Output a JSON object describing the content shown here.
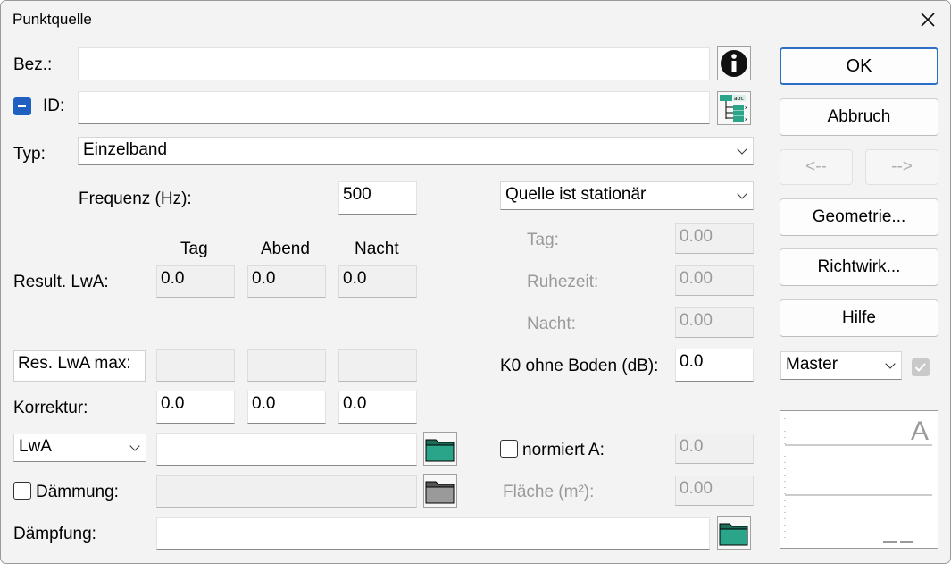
{
  "window": {
    "title": "Punktquelle"
  },
  "labels": {
    "bez": "Bez.:",
    "id": "ID:",
    "typ": "Typ:",
    "frequenz": "Frequenz (Hz):",
    "tag": "Tag",
    "abend": "Abend",
    "nacht": "Nacht",
    "result": "Result. LwA:",
    "korrektur": "Korrektur:",
    "daemmung": "Dämmung:",
    "daempfung": "Dämpfung:",
    "r_tag": "Tag:",
    "r_ruhezeit": "Ruhezeit:",
    "r_nacht": "Nacht:",
    "k0": "K0 ohne Boden (dB):",
    "normiert": "normiert A:",
    "flaeche": "Fläche (m²):"
  },
  "fields": {
    "bez": "",
    "id": "",
    "typ": "Einzelband",
    "frequenz": "500",
    "stationaer": "Quelle ist stationär",
    "result_tag": "0.0",
    "result_abend": "0.0",
    "result_nacht": "0.0",
    "korr_tag": "0.0",
    "korr_abend": "0.0",
    "korr_nacht": "0.0",
    "lwa_select": "LwA",
    "lwa_file": "",
    "daemmung_file": "",
    "daempfung": "",
    "r_tag": "0.00",
    "r_ruhezeit": "0.00",
    "r_nacht": "0.00",
    "k0": "0.0",
    "normiert": "0.0",
    "flaeche": "0.00",
    "master": "Master"
  },
  "buttons": {
    "ok": "OK",
    "abbruch": "Abbruch",
    "prev": "<--",
    "next": "-->",
    "geometrie": "Geometrie...",
    "richtwirk": "Richtwirk...",
    "hilfe": "Hilfe",
    "res_lwa_max": "Res. LwA max:"
  },
  "preview": {
    "letter": "A"
  },
  "icons": [
    "close-icon",
    "info-icon",
    "tree-icon",
    "folder-icon",
    "chevron-down-icon"
  ],
  "colors": {
    "accent": "#1f5fbf",
    "folder": "#2aa58a"
  }
}
